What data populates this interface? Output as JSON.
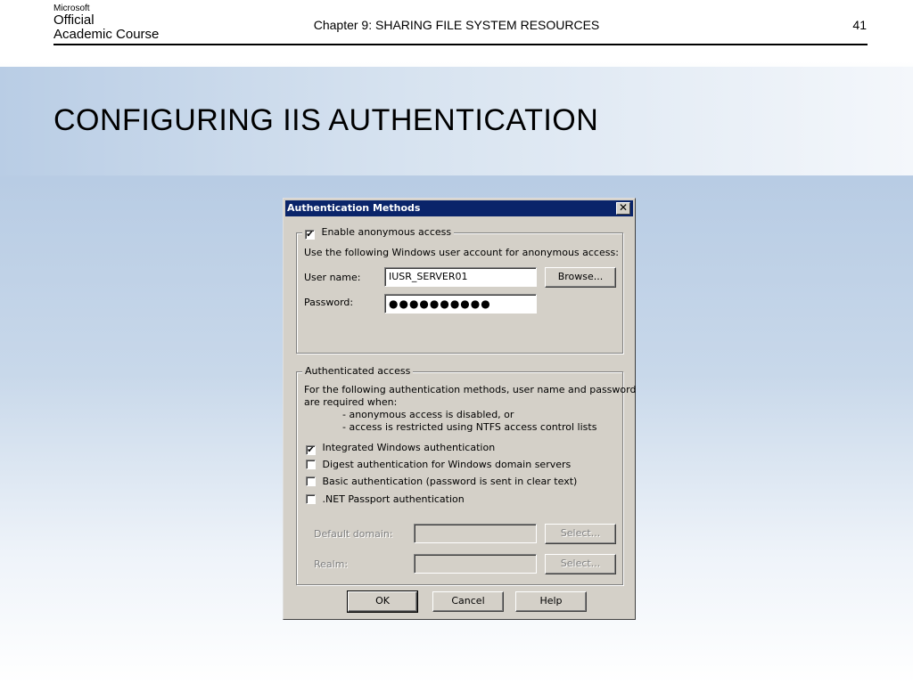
{
  "header": {
    "logo_line1": "Microsoft",
    "logo_line2": "Official",
    "logo_line3": "Academic Course",
    "chapter": "Chapter 9: SHARING FILE SYSTEM RESOURCES",
    "page_number": "41"
  },
  "slide_title": "CONFIGURING IIS AUTHENTICATION",
  "dialog": {
    "title": "Authentication Methods",
    "close_glyph": "✕",
    "anonymous": {
      "checkbox_label": "Enable anonymous access",
      "checked": true,
      "description": "Use the following Windows user account for anonymous access:",
      "username_label": "User name:",
      "username_value": "IUSR_SERVER01",
      "browse_label": "Browse...",
      "password_label": "Password:",
      "password_value": "●●●●●●●●●●"
    },
    "authenticated": {
      "legend": "Authenticated access",
      "description_line1": "For the following authentication methods, user name and password",
      "description_line2": "are required when:",
      "bullet1": "- anonymous access is disabled, or",
      "bullet2": "- access is restricted using NTFS access control lists",
      "options": [
        {
          "label": "Integrated Windows authentication",
          "checked": true
        },
        {
          "label": "Digest authentication for Windows domain servers",
          "checked": false
        },
        {
          "label": "Basic authentication (password is sent in clear text)",
          "checked": false
        },
        {
          "label": ".NET Passport authentication",
          "checked": false
        }
      ],
      "default_domain_label": "Default domain:",
      "default_domain_value": "",
      "realm_label": "Realm:",
      "realm_value": "",
      "select_label": "Select..."
    },
    "buttons": {
      "ok": "OK",
      "cancel": "Cancel",
      "help": "Help"
    },
    "check_glyph": "✔"
  }
}
